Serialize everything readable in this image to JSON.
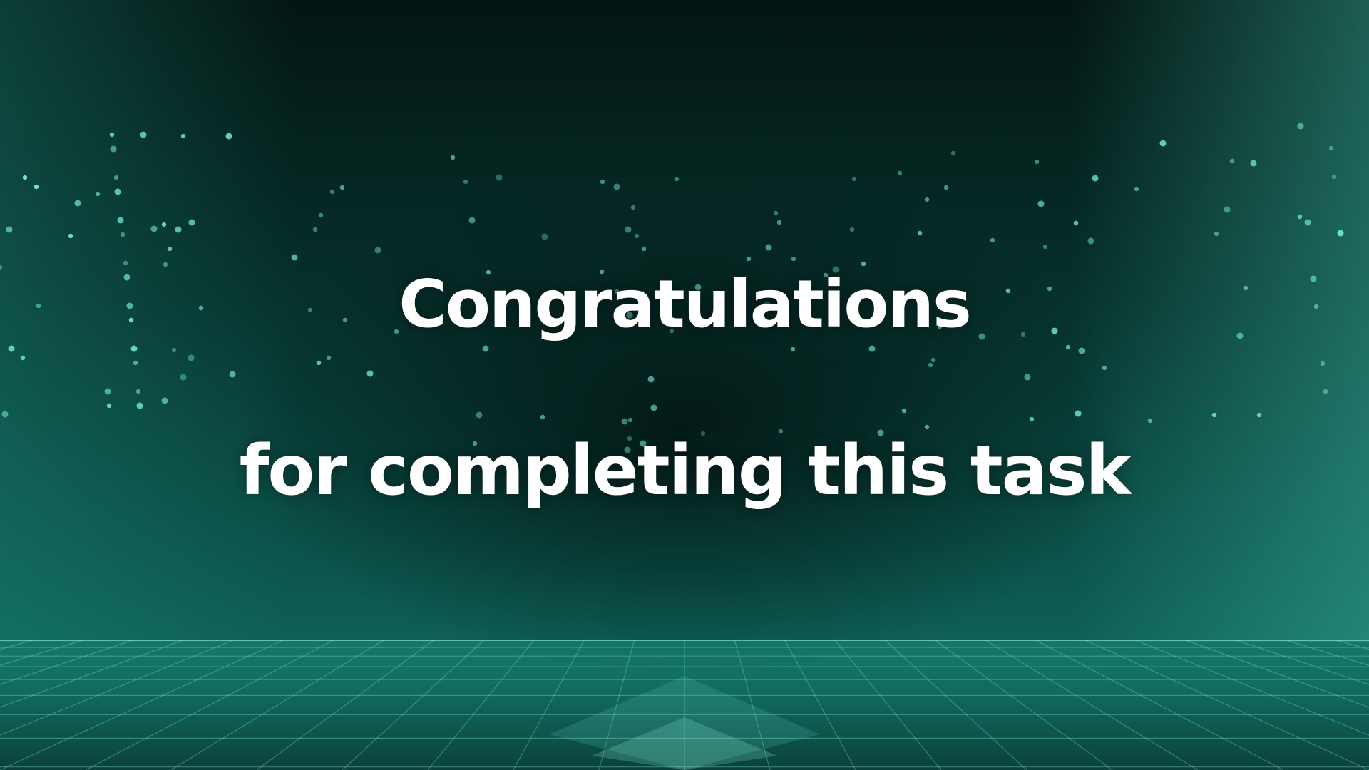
{
  "screen": {
    "headline_line1": "Congratulations",
    "headline_line2": "for completing this task"
  },
  "theme": {
    "accent": "#2fb8a3",
    "background_dark": "#031512",
    "text": "#ffffff"
  },
  "decor": {
    "background_icon": "circuit-lines-icon",
    "floor_icon": "perspective-grid-icon"
  }
}
